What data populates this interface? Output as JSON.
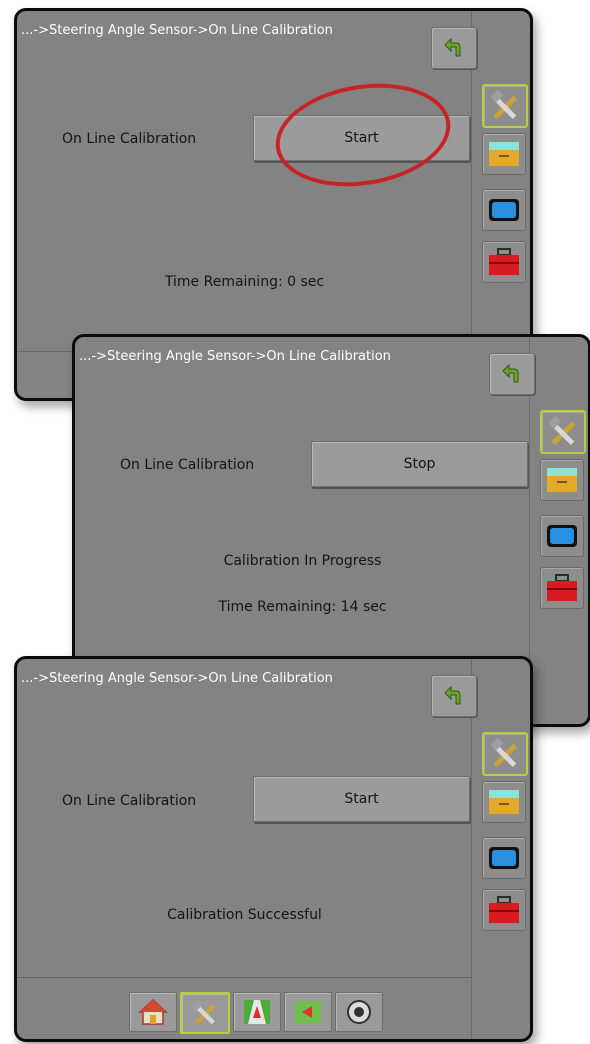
{
  "screens": [
    {
      "breadcrumb": "...->Steering Angle Sensor->On Line Calibration",
      "field_label": "On Line Calibration",
      "action_label": "Start",
      "status_text": "Time Remaining: 0 sec"
    },
    {
      "breadcrumb": "...->Steering Angle Sensor->On Line Calibration",
      "field_label": "On Line Calibration",
      "action_label": "Stop",
      "status_text": "Calibration In Progress",
      "remaining_text": "Time Remaining: 14 sec"
    },
    {
      "breadcrumb": "...->Steering Angle Sensor->On Line Calibration",
      "field_label": "On Line Calibration",
      "action_label": "Start",
      "status_text": "Calibration Successful"
    }
  ],
  "icons": {
    "back": "back-arrow-icon",
    "sidebar": [
      "tools-icon",
      "console-icon",
      "display-icon",
      "toolbox-icon"
    ],
    "bottom_nav": [
      "home-icon",
      "tools-icon",
      "guidance-icon",
      "map-icon",
      "system-icon"
    ]
  },
  "colors": {
    "panel": "#838383",
    "active_outline": "#b7cf3f",
    "highlight_ring": "#c62424",
    "back_arrow": "#6aa52a"
  }
}
